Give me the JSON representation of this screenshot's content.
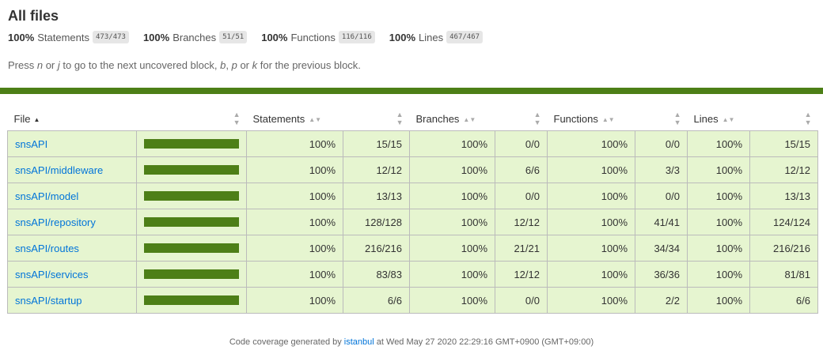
{
  "title": "All files",
  "summary": [
    {
      "pct": "100%",
      "label": "Statements",
      "fraction": "473/473"
    },
    {
      "pct": "100%",
      "label": "Branches",
      "fraction": "51/51"
    },
    {
      "pct": "100%",
      "label": "Functions",
      "fraction": "116/116"
    },
    {
      "pct": "100%",
      "label": "Lines",
      "fraction": "467/467"
    }
  ],
  "help": {
    "t1": "Press ",
    "k1": "n",
    "t2": " or ",
    "k2": "j",
    "t3": " to go to the next uncovered block, ",
    "k3": "b",
    "t4": ", ",
    "k4": "p",
    "t5": " or ",
    "k5": "k",
    "t6": " for the previous block."
  },
  "table": {
    "headers": {
      "file": "File",
      "statements": "Statements",
      "branches": "Branches",
      "functions": "Functions",
      "lines": "Lines"
    },
    "rows": [
      {
        "file": "snsAPI",
        "coverage": 1.0,
        "s_pct": "100%",
        "s_frac": "15/15",
        "b_pct": "100%",
        "b_frac": "0/0",
        "f_pct": "100%",
        "f_frac": "0/0",
        "l_pct": "100%",
        "l_frac": "15/15"
      },
      {
        "file": "snsAPI/middleware",
        "coverage": 1.0,
        "s_pct": "100%",
        "s_frac": "12/12",
        "b_pct": "100%",
        "b_frac": "6/6",
        "f_pct": "100%",
        "f_frac": "3/3",
        "l_pct": "100%",
        "l_frac": "12/12"
      },
      {
        "file": "snsAPI/model",
        "coverage": 1.0,
        "s_pct": "100%",
        "s_frac": "13/13",
        "b_pct": "100%",
        "b_frac": "0/0",
        "f_pct": "100%",
        "f_frac": "0/0",
        "l_pct": "100%",
        "l_frac": "13/13"
      },
      {
        "file": "snsAPI/repository",
        "coverage": 1.0,
        "s_pct": "100%",
        "s_frac": "128/128",
        "b_pct": "100%",
        "b_frac": "12/12",
        "f_pct": "100%",
        "f_frac": "41/41",
        "l_pct": "100%",
        "l_frac": "124/124"
      },
      {
        "file": "snsAPI/routes",
        "coverage": 1.0,
        "s_pct": "100%",
        "s_frac": "216/216",
        "b_pct": "100%",
        "b_frac": "21/21",
        "f_pct": "100%",
        "f_frac": "34/34",
        "l_pct": "100%",
        "l_frac": "216/216"
      },
      {
        "file": "snsAPI/services",
        "coverage": 1.0,
        "s_pct": "100%",
        "s_frac": "83/83",
        "b_pct": "100%",
        "b_frac": "12/12",
        "f_pct": "100%",
        "f_frac": "36/36",
        "l_pct": "100%",
        "l_frac": "81/81"
      },
      {
        "file": "snsAPI/startup",
        "coverage": 1.0,
        "s_pct": "100%",
        "s_frac": "6/6",
        "b_pct": "100%",
        "b_frac": "0/0",
        "f_pct": "100%",
        "f_frac": "2/2",
        "l_pct": "100%",
        "l_frac": "6/6"
      }
    ]
  },
  "footer": {
    "pre": "Code coverage generated by ",
    "link": "istanbul",
    "post": " at Wed May 27 2020 22:29:16 GMT+0900 (GMT+09:00)"
  },
  "colors": {
    "bar": "#4d7f17",
    "row_bg": "#e6f5d0",
    "link": "#0074d9"
  }
}
